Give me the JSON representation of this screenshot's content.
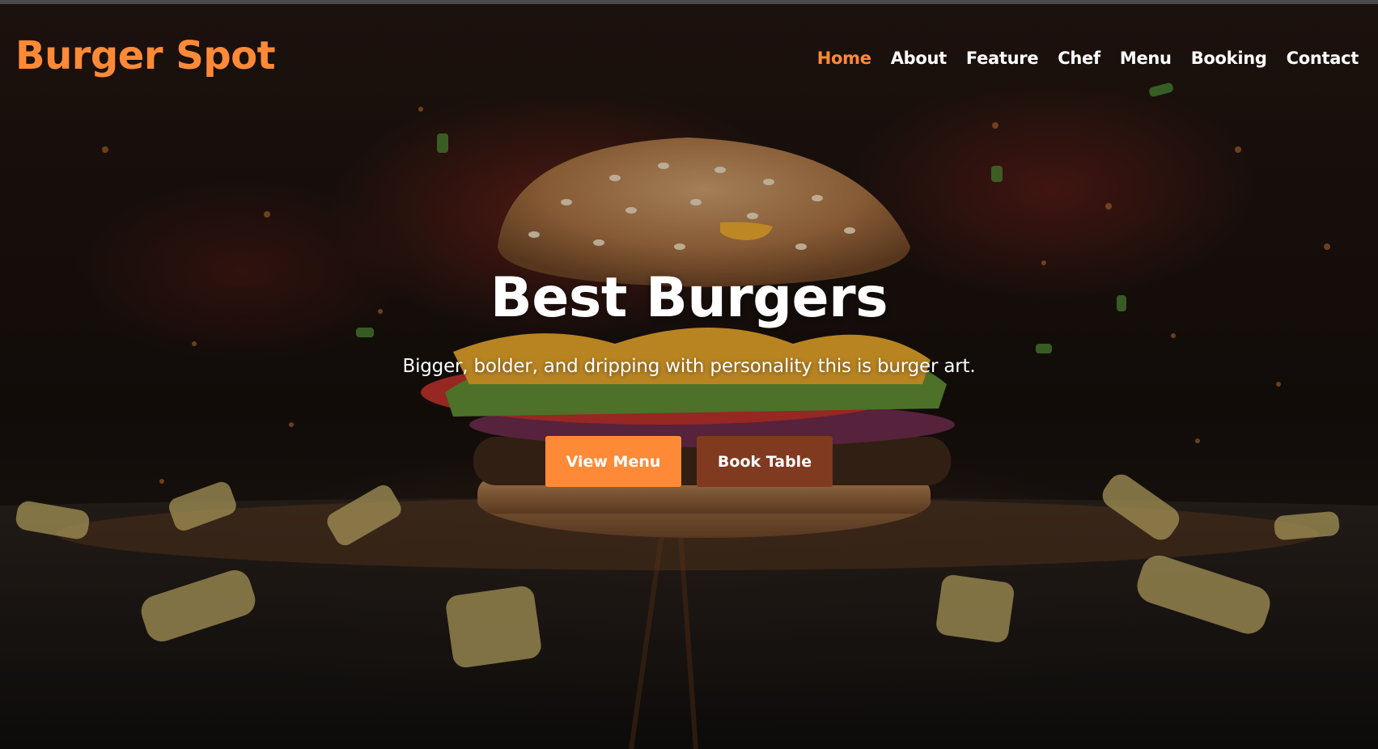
{
  "brand": {
    "name": "Burger Spot",
    "accent_color": "#fe8a37"
  },
  "nav": {
    "items": [
      {
        "label": "Home",
        "active": true
      },
      {
        "label": "About",
        "active": false
      },
      {
        "label": "Feature",
        "active": false
      },
      {
        "label": "Chef",
        "active": false
      },
      {
        "label": "Menu",
        "active": false
      },
      {
        "label": "Booking",
        "active": false
      },
      {
        "label": "Contact",
        "active": false
      }
    ]
  },
  "hero": {
    "title": "Best Burgers",
    "subtitle": "Bigger, bolder, and dripping with personality this is burger art.",
    "primary_button": "View Menu",
    "secondary_button": "Book Table",
    "secondary_color": "#7f3a20"
  }
}
